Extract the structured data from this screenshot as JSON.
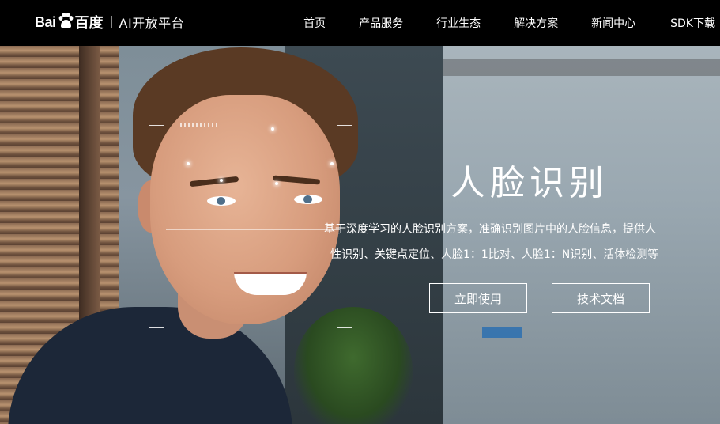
{
  "brand": {
    "bai": "Bai",
    "du": "百度",
    "product": "AI开放平台"
  },
  "nav": {
    "items": [
      "首页",
      "产品服务",
      "行业生态",
      "解决方案",
      "新闻中心",
      "SDK下载"
    ]
  },
  "hero": {
    "title": "人脸识别",
    "desc_line1": "基于深度学习的人脸识别方案，准确识别图片中的人脸信息，提供人",
    "desc_line2": "性识别、关键点定位、人脸1：1比对、人脸1：N识别、活体检测等",
    "btn_use": "立即使用",
    "btn_docs": "技术文档"
  },
  "colors": {
    "topbar": "#000000",
    "text": "#ffffff"
  }
}
